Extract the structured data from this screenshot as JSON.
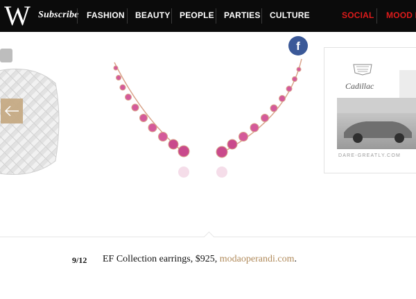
{
  "nav": {
    "logo": "W",
    "items": [
      {
        "label": "Subscribe",
        "style": "subscribe"
      },
      {
        "label": "FASHION"
      },
      {
        "label": "BEAUTY"
      },
      {
        "label": "PEOPLE"
      },
      {
        "label": "PARTIES"
      },
      {
        "label": "CULTURE"
      },
      {
        "label": "SOCIAL",
        "color": "#e01b1b"
      },
      {
        "label": "MOOD BO",
        "color": "#e01b1b"
      }
    ]
  },
  "slideshow": {
    "prev_icon": "arrow-left-icon",
    "next_icon": "arrow-right-icon",
    "share": {
      "label": "f",
      "icon": "facebook-icon",
      "color": "#3b5998"
    }
  },
  "ad": {
    "brand": "Cadillac",
    "cta": "DARE-GREATLY.COM"
  },
  "caption": {
    "index": "9",
    "total": "12",
    "text": "EF Collection earrings, $925, ",
    "link": "modaoperandi.com",
    "end": "."
  },
  "colors": {
    "nav_bg": "#0b0b0b",
    "accent_red": "#e01b1b",
    "arrow_gold": "#c6ab85",
    "link_gold": "#b08a5a"
  }
}
